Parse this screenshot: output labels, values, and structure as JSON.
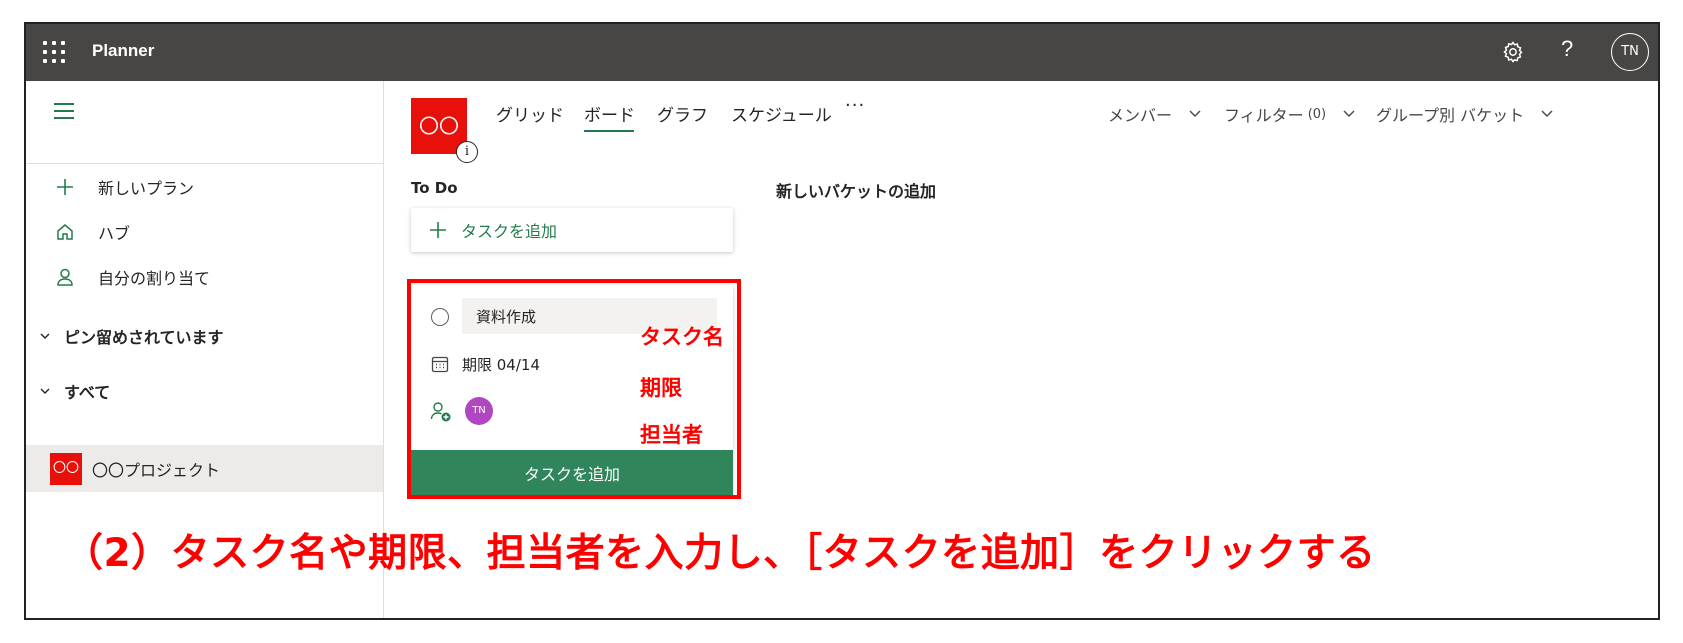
{
  "topbar": {
    "app_title": "Planner",
    "icons": [
      "waffle-icon",
      "gear-icon",
      "help-icon"
    ],
    "help_glyph": "?",
    "user_initials": "TN",
    "background": "#484644"
  },
  "sidebar": {
    "nav": [
      {
        "label": "新しいプラン",
        "icon": "plus-icon"
      },
      {
        "label": "ハブ",
        "icon": "home-icon"
      },
      {
        "label": "自分の割り当て",
        "icon": "person-icon"
      }
    ],
    "sections": [
      {
        "label": "ピン留めされています"
      },
      {
        "label": "すべて"
      }
    ],
    "plan": {
      "logo_text": "〇〇",
      "label": "〇〇プロジェクト"
    }
  },
  "plan_header": {
    "logo_text": "〇〇",
    "info_glyph": "i",
    "tabs": [
      {
        "label": "グリッド"
      },
      {
        "label": "ボード",
        "active": true
      },
      {
        "label": "グラフ"
      },
      {
        "label": "スケジュール"
      }
    ],
    "more_glyph": "···",
    "right": {
      "members": "メンバー",
      "filter": "フィルター",
      "filter_count": "(0)",
      "group_by": "グループ別 バケット"
    }
  },
  "board": {
    "bucket_title": "To Do",
    "add_task_label": "タスクを追加",
    "new_bucket_label": "新しいバケットの追加",
    "form": {
      "task_name": "資料作成",
      "due": "期限 04/14",
      "assignee_initials": "TN",
      "submit_label": "タスクを追加"
    }
  },
  "annotations": {
    "task_name": "タスク名",
    "due": "期限",
    "assignee": "担当者",
    "caption": "（2）タスク名や期限、担当者を入力し、［タスクを追加］をクリックする"
  },
  "colors": {
    "accent_green": "#237b4b",
    "button_green": "#31855a",
    "plan_red": "#e8100a",
    "assignee_purple": "#b146c2",
    "annotation_red": "#ff0000"
  }
}
